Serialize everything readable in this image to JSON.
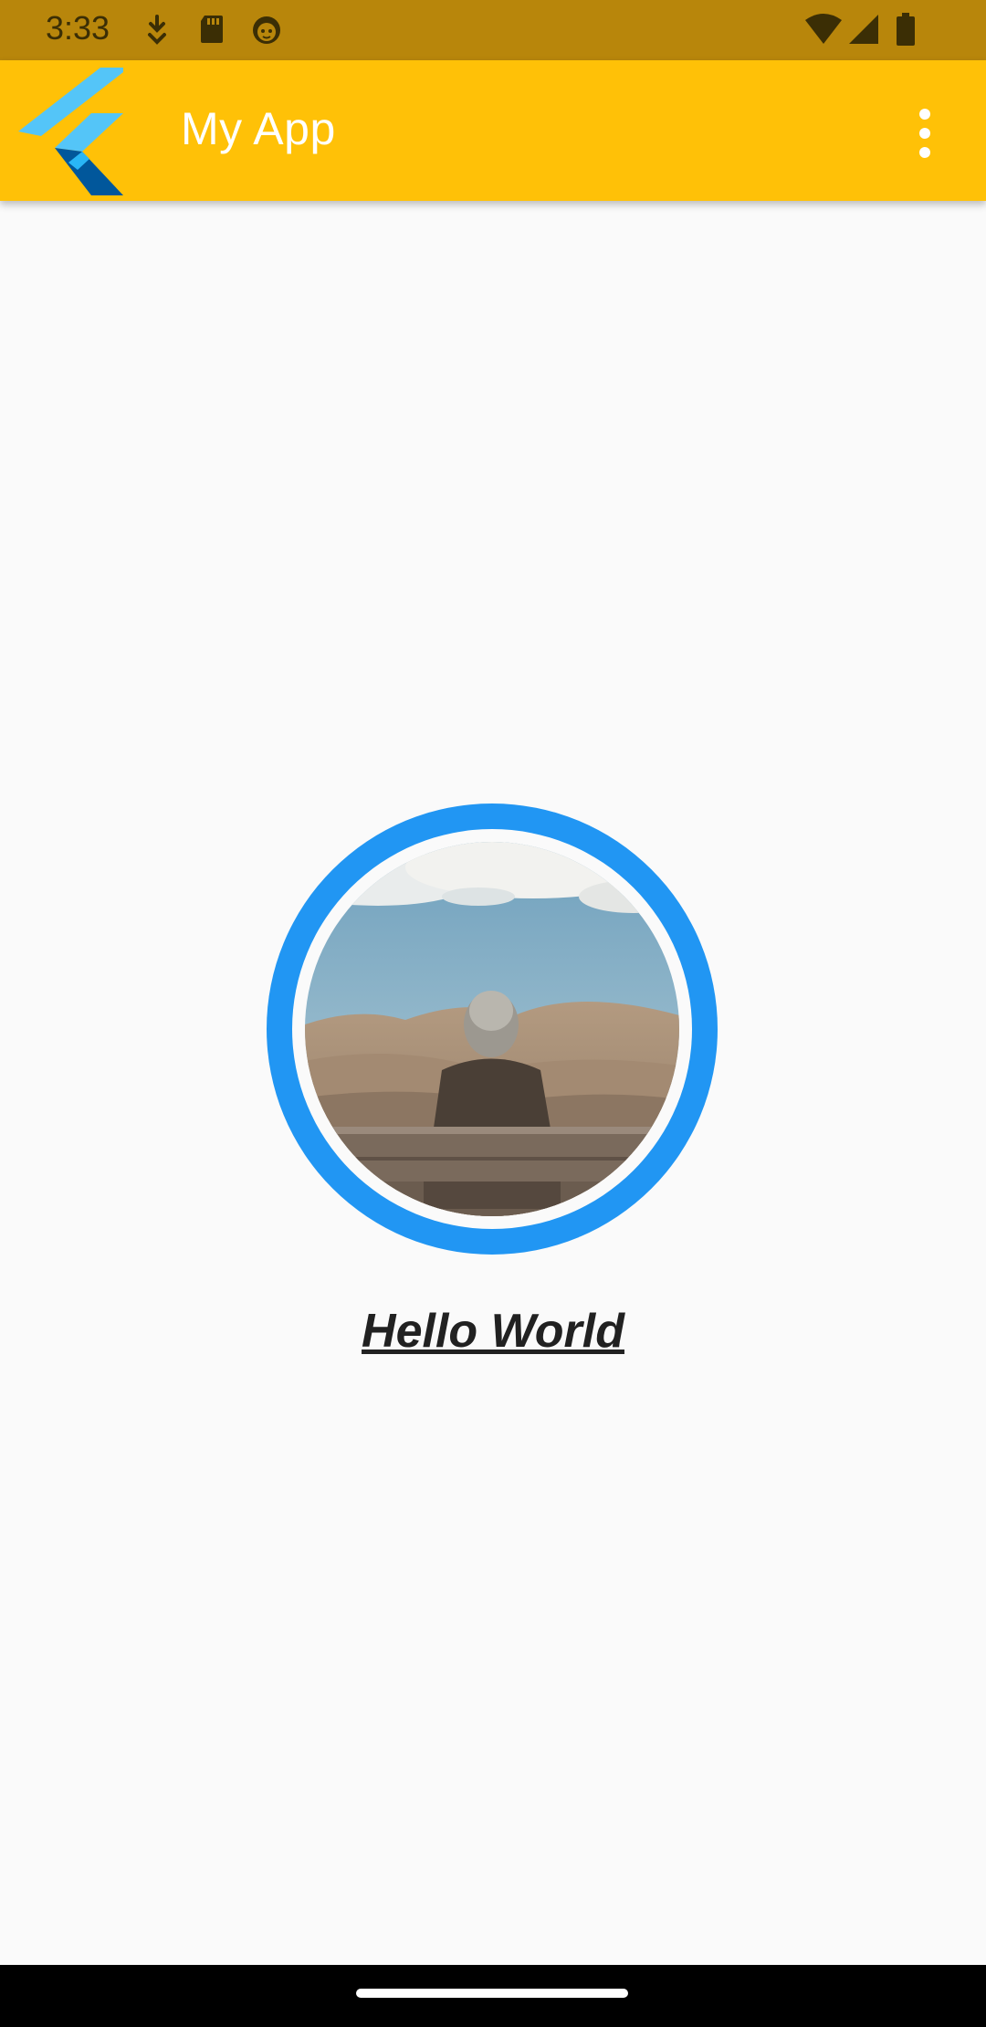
{
  "status_bar": {
    "time": "3:33",
    "left_icons": [
      "download-icon",
      "sd-card-icon",
      "android-face-icon"
    ],
    "right_icons": [
      "wifi-icon",
      "signal-icon",
      "battery-icon"
    ],
    "background_color": "#b8860b"
  },
  "app_bar": {
    "title": "My App",
    "logo": "flutter-logo",
    "menu_icon": "more-vert-icon",
    "background_color": "#ffc107"
  },
  "main": {
    "avatar": {
      "ring_color": "#2196f3",
      "image_description_icon": "person-on-bench-photo"
    },
    "greeting": "Hello World"
  },
  "nav_bar": {
    "background_color": "#000000"
  }
}
